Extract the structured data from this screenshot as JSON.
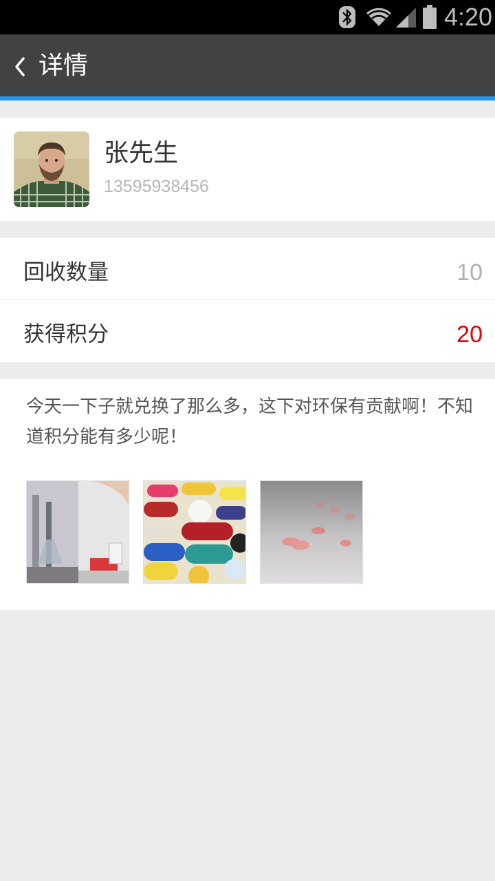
{
  "status_bar": {
    "time": "4:20",
    "icons": [
      "bluetooth-icon",
      "wifi-icon",
      "signal-icon",
      "battery-icon"
    ]
  },
  "header": {
    "back_icon": "chevron-left-icon",
    "title": "详情",
    "colors": {
      "bar": "#424242",
      "accent": "#2196f3"
    }
  },
  "profile": {
    "name": "张先生",
    "phone": "13595938456"
  },
  "stats": [
    {
      "label": "回收数量",
      "value": "10",
      "color": "#b0b0b0"
    },
    {
      "label": "获得积分",
      "value": "20",
      "color": "#e60000"
    }
  ],
  "post": {
    "text": "今天一下子就兑换了那么多，这下对环保有贡献啊！不知道积分能有多少呢！",
    "images": [
      "lab-photo",
      "colorful-pills-photo",
      "pink-tablets-photo"
    ]
  }
}
